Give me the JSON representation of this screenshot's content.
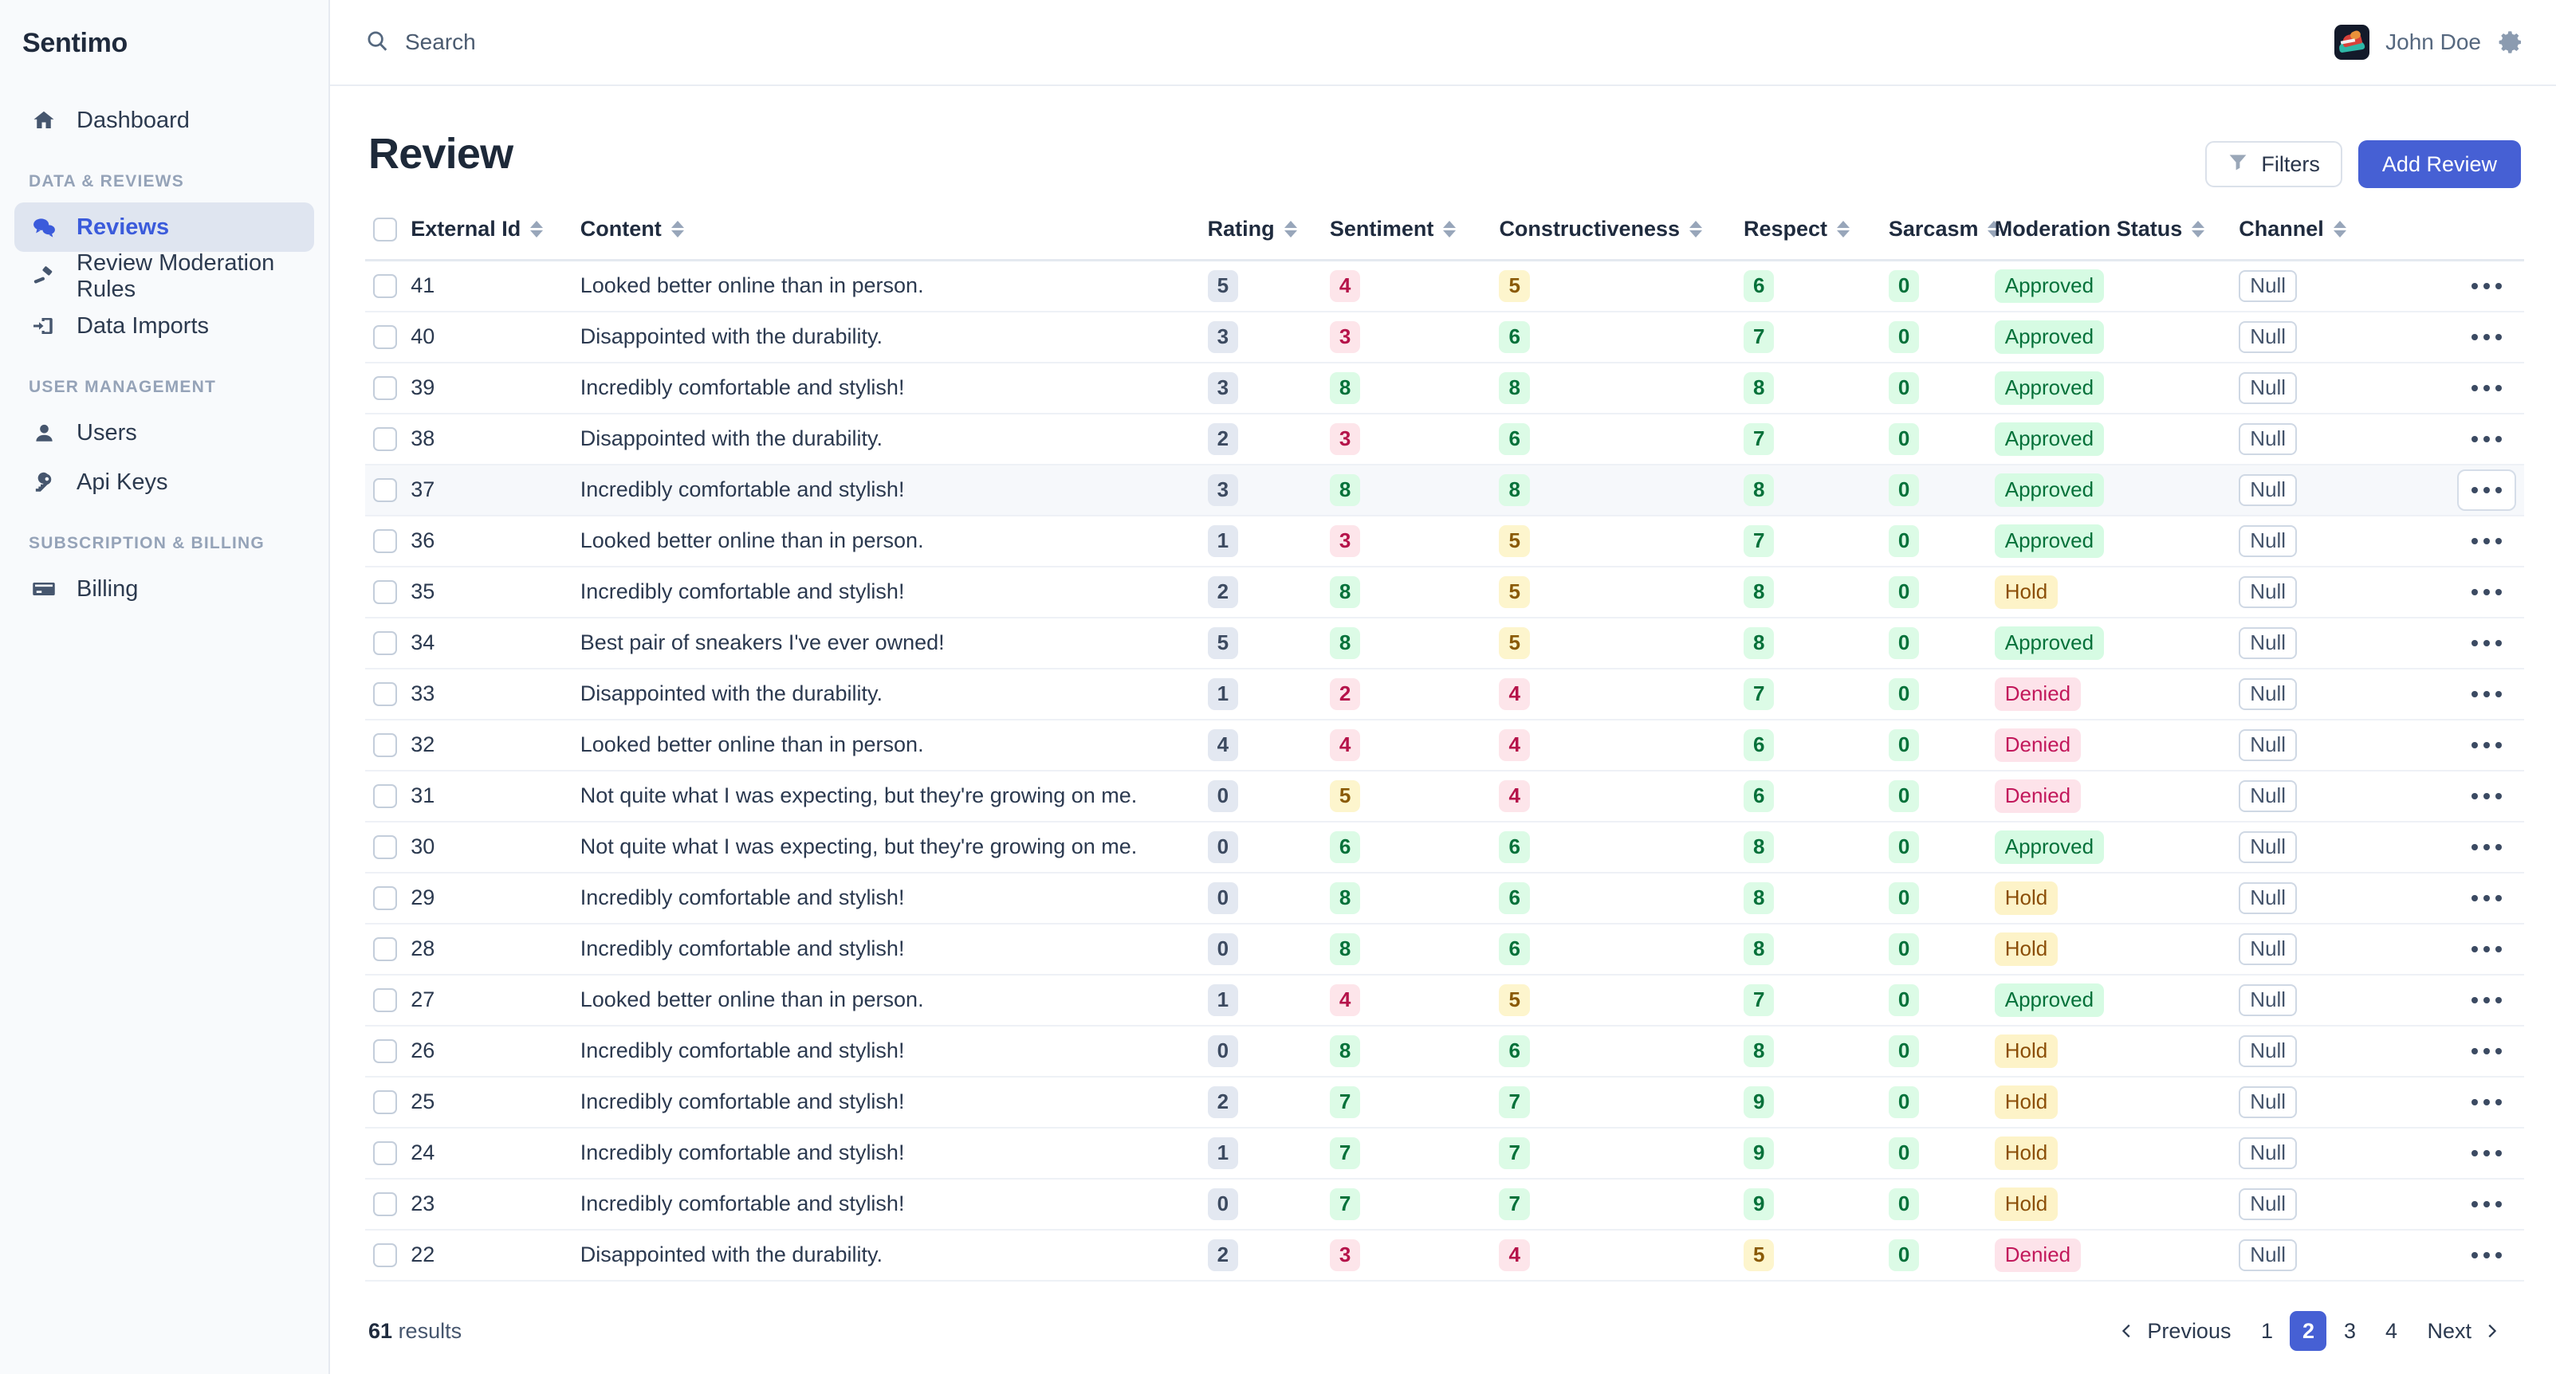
{
  "brand": {
    "name": "Sentimo"
  },
  "sidebar": {
    "items": [
      {
        "label": "Dashboard",
        "icon": "home-icon",
        "active": false
      },
      {
        "label": "Reviews",
        "icon": "chat-bubbles-icon",
        "active": true
      },
      {
        "label": "Review Moderation Rules",
        "icon": "gavel-icon",
        "active": false
      },
      {
        "label": "Data Imports",
        "icon": "import-arrow-icon",
        "active": false
      },
      {
        "label": "Users",
        "icon": "user-icon",
        "active": false
      },
      {
        "label": "Api Keys",
        "icon": "key-icon",
        "active": false
      },
      {
        "label": "Billing",
        "icon": "credit-card-icon",
        "active": false
      }
    ],
    "sections": {
      "data_reviews": "DATA & REVIEWS",
      "user_management": "USER MANAGEMENT",
      "subscription_billing": "SUBSCRIPTION & BILLING"
    }
  },
  "topbar": {
    "search_placeholder": "Search",
    "search_value": "",
    "user_name": "John Doe",
    "avatar_icon": "sneaker-avatar",
    "settings_icon": "gear-icon"
  },
  "page": {
    "title": "Review",
    "filters_label": "Filters",
    "add_label": "Add Review"
  },
  "table": {
    "columns": [
      {
        "key": "external_id",
        "label": "External Id",
        "sortable": true
      },
      {
        "key": "content",
        "label": "Content",
        "sortable": true
      },
      {
        "key": "rating",
        "label": "Rating",
        "sortable": true
      },
      {
        "key": "sentiment",
        "label": "Sentiment",
        "sortable": true
      },
      {
        "key": "constructiveness",
        "label": "Constructiveness",
        "sortable": true
      },
      {
        "key": "respect",
        "label": "Respect",
        "sortable": true
      },
      {
        "key": "sarcasm",
        "label": "Sarcasm",
        "sortable": true
      },
      {
        "key": "moderation_status",
        "label": "Moderation Status",
        "sortable": true
      },
      {
        "key": "channel",
        "label": "Channel",
        "sortable": true
      }
    ],
    "null_label": "Null",
    "rows": [
      {
        "external_id": "41",
        "content": "Looked better online than in person.",
        "rating": "5",
        "sentiment": "4",
        "constructiveness": "5",
        "respect": "6",
        "sarcasm": "0",
        "moderation_status": "Approved",
        "channel": "Null",
        "hover": false
      },
      {
        "external_id": "40",
        "content": "Disappointed with the durability.",
        "rating": "3",
        "sentiment": "3",
        "constructiveness": "6",
        "respect": "7",
        "sarcasm": "0",
        "moderation_status": "Approved",
        "channel": "Null",
        "hover": false
      },
      {
        "external_id": "39",
        "content": "Incredibly comfortable and stylish!",
        "rating": "3",
        "sentiment": "8",
        "constructiveness": "8",
        "respect": "8",
        "sarcasm": "0",
        "moderation_status": "Approved",
        "channel": "Null",
        "hover": false
      },
      {
        "external_id": "38",
        "content": "Disappointed with the durability.",
        "rating": "2",
        "sentiment": "3",
        "constructiveness": "6",
        "respect": "7",
        "sarcasm": "0",
        "moderation_status": "Approved",
        "channel": "Null",
        "hover": false
      },
      {
        "external_id": "37",
        "content": "Incredibly comfortable and stylish!",
        "rating": "3",
        "sentiment": "8",
        "constructiveness": "8",
        "respect": "8",
        "sarcasm": "0",
        "moderation_status": "Approved",
        "channel": "Null",
        "hover": true
      },
      {
        "external_id": "36",
        "content": "Looked better online than in person.",
        "rating": "1",
        "sentiment": "3",
        "constructiveness": "5",
        "respect": "7",
        "sarcasm": "0",
        "moderation_status": "Approved",
        "channel": "Null",
        "hover": false
      },
      {
        "external_id": "35",
        "content": "Incredibly comfortable and stylish!",
        "rating": "2",
        "sentiment": "8",
        "constructiveness": "5",
        "respect": "8",
        "sarcasm": "0",
        "moderation_status": "Hold",
        "channel": "Null",
        "hover": false
      },
      {
        "external_id": "34",
        "content": "Best pair of sneakers I've ever owned!",
        "rating": "5",
        "sentiment": "8",
        "constructiveness": "5",
        "respect": "8",
        "sarcasm": "0",
        "moderation_status": "Approved",
        "channel": "Null",
        "hover": false
      },
      {
        "external_id": "33",
        "content": "Disappointed with the durability.",
        "rating": "1",
        "sentiment": "2",
        "constructiveness": "4",
        "respect": "7",
        "sarcasm": "0",
        "moderation_status": "Denied",
        "channel": "Null",
        "hover": false
      },
      {
        "external_id": "32",
        "content": "Looked better online than in person.",
        "rating": "4",
        "sentiment": "4",
        "constructiveness": "4",
        "respect": "6",
        "sarcasm": "0",
        "moderation_status": "Denied",
        "channel": "Null",
        "hover": false
      },
      {
        "external_id": "31",
        "content": "Not quite what I was expecting, but they're growing on me.",
        "rating": "0",
        "sentiment": "5",
        "constructiveness": "4",
        "respect": "6",
        "sarcasm": "0",
        "moderation_status": "Denied",
        "channel": "Null",
        "hover": false
      },
      {
        "external_id": "30",
        "content": "Not quite what I was expecting, but they're growing on me.",
        "rating": "0",
        "sentiment": "6",
        "constructiveness": "6",
        "respect": "8",
        "sarcasm": "0",
        "moderation_status": "Approved",
        "channel": "Null",
        "hover": false
      },
      {
        "external_id": "29",
        "content": "Incredibly comfortable and stylish!",
        "rating": "0",
        "sentiment": "8",
        "constructiveness": "6",
        "respect": "8",
        "sarcasm": "0",
        "moderation_status": "Hold",
        "channel": "Null",
        "hover": false
      },
      {
        "external_id": "28",
        "content": "Incredibly comfortable and stylish!",
        "rating": "0",
        "sentiment": "8",
        "constructiveness": "6",
        "respect": "8",
        "sarcasm": "0",
        "moderation_status": "Hold",
        "channel": "Null",
        "hover": false
      },
      {
        "external_id": "27",
        "content": "Looked better online than in person.",
        "rating": "1",
        "sentiment": "4",
        "constructiveness": "5",
        "respect": "7",
        "sarcasm": "0",
        "moderation_status": "Approved",
        "channel": "Null",
        "hover": false
      },
      {
        "external_id": "26",
        "content": "Incredibly comfortable and stylish!",
        "rating": "0",
        "sentiment": "8",
        "constructiveness": "6",
        "respect": "8",
        "sarcasm": "0",
        "moderation_status": "Hold",
        "channel": "Null",
        "hover": false
      },
      {
        "external_id": "25",
        "content": "Incredibly comfortable and stylish!",
        "rating": "2",
        "sentiment": "7",
        "constructiveness": "7",
        "respect": "9",
        "sarcasm": "0",
        "moderation_status": "Hold",
        "channel": "Null",
        "hover": false
      },
      {
        "external_id": "24",
        "content": "Incredibly comfortable and stylish!",
        "rating": "1",
        "sentiment": "7",
        "constructiveness": "7",
        "respect": "9",
        "sarcasm": "0",
        "moderation_status": "Hold",
        "channel": "Null",
        "hover": false
      },
      {
        "external_id": "23",
        "content": "Incredibly comfortable and stylish!",
        "rating": "0",
        "sentiment": "7",
        "constructiveness": "7",
        "respect": "9",
        "sarcasm": "0",
        "moderation_status": "Hold",
        "channel": "Null",
        "hover": false
      },
      {
        "external_id": "22",
        "content": "Disappointed with the durability.",
        "rating": "2",
        "sentiment": "3",
        "constructiveness": "4",
        "respect": "5",
        "sarcasm": "0",
        "moderation_status": "Denied",
        "channel": "Null",
        "hover": false
      }
    ]
  },
  "footer": {
    "results_count": "61",
    "results_word": "results",
    "previous_label": "Previous",
    "next_label": "Next",
    "pages": [
      "1",
      "2",
      "3",
      "4"
    ],
    "current_page": "2"
  },
  "colors": {
    "accent": "#4660d4",
    "good": "#dcfbe6",
    "warn": "#fdf5cd",
    "bad": "#fde5ea",
    "sidebar_active": "#dfe5f0"
  }
}
